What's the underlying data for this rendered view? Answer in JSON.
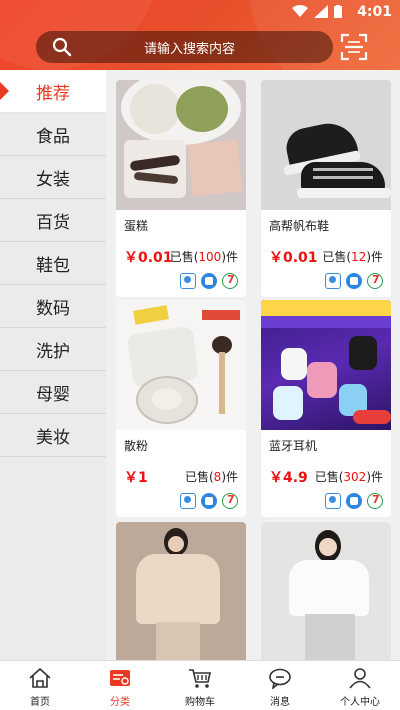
{
  "status_bar": {
    "time": "4:01"
  },
  "search": {
    "placeholder": "请输入搜索内容"
  },
  "sidebar": {
    "items": [
      {
        "label": "推荐",
        "active": true
      },
      {
        "label": "食品"
      },
      {
        "label": "女装"
      },
      {
        "label": "百货"
      },
      {
        "label": "鞋包"
      },
      {
        "label": "数码"
      },
      {
        "label": "洗护"
      },
      {
        "label": "母婴"
      },
      {
        "label": "美妆"
      }
    ]
  },
  "products": [
    {
      "name": "蛋糕",
      "price": "￥0.01",
      "sold_prefix": "已售(",
      "sold_count": "100",
      "sold_suffix": ")件"
    },
    {
      "name": "高帮帆布鞋",
      "price": "￥0.01",
      "sold_prefix": "已售(",
      "sold_count": "12",
      "sold_suffix": ")件"
    },
    {
      "name": "散粉",
      "price": "￥1",
      "sold_prefix": "已售(",
      "sold_count": "8",
      "sold_suffix": ")件"
    },
    {
      "name": "蓝牙耳机",
      "price": "￥4.9",
      "sold_prefix": "已售(",
      "sold_count": "302",
      "sold_suffix": ")件"
    },
    {
      "name": "",
      "price": "",
      "sold_prefix": "",
      "sold_count": "",
      "sold_suffix": ""
    },
    {
      "name": "",
      "price": "",
      "sold_prefix": "",
      "sold_count": "",
      "sold_suffix": ""
    }
  ],
  "tabbar": {
    "items": [
      {
        "label": "首页",
        "icon": "home-icon"
      },
      {
        "label": "分类",
        "icon": "category-icon",
        "active": true
      },
      {
        "label": "购物车",
        "icon": "cart-icon"
      },
      {
        "label": "消息",
        "icon": "message-icon"
      },
      {
        "label": "个人中心",
        "icon": "user-icon"
      }
    ]
  },
  "colors": {
    "accent": "#e83a22",
    "price": "#ee1111"
  }
}
